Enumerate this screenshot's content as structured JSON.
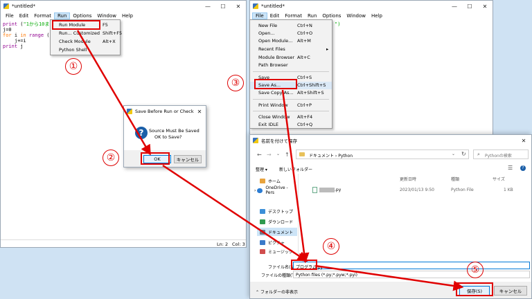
{
  "left_window": {
    "title": "*untitled*",
    "menu": [
      "File",
      "Edit",
      "Format",
      "Run",
      "Options",
      "Window",
      "Help"
    ],
    "code": [
      [
        [
          "bi",
          "print"
        ],
        [
          "t",
          " ("
        ],
        [
          "str",
          "\"1から10ま"
        ]
      ],
      [
        [
          "t",
          "j=0"
        ]
      ],
      [
        [
          "kw",
          "for"
        ],
        [
          "t",
          " i "
        ],
        [
          "kw",
          "in"
        ],
        [
          "t",
          " "
        ],
        [
          "bi",
          "range"
        ],
        [
          "t",
          " ("
        ]
      ],
      [
        [
          "t",
          "    j+=i"
        ]
      ],
      [
        [
          "bi",
          "print"
        ],
        [
          "t",
          " j"
        ]
      ]
    ],
    "status_ln": "Ln: 2",
    "status_col": "Col: 3"
  },
  "run_menu": {
    "items": [
      {
        "label": "Run Module",
        "shortcut": "F5"
      },
      {
        "label": "Run... Customized",
        "shortcut": "Shift+F5"
      },
      {
        "label": "Check Module",
        "shortcut": "Alt+X"
      },
      {
        "label": "Python Shell",
        "shortcut": ""
      }
    ]
  },
  "dialog": {
    "title": "Save Before Run or Check",
    "line1": "Source Must Be Saved",
    "line2": "OK to Save?",
    "ok_label": "OK",
    "cancel_label": "キャンセル"
  },
  "right_window": {
    "title": "*untitled*",
    "menu": [
      "File",
      "Edit",
      "Format",
      "Run",
      "Options",
      "Window",
      "Help"
    ],
    "code_fragment": "\")"
  },
  "file_menu": {
    "items": [
      {
        "label": "New File",
        "shortcut": "Ctrl+N"
      },
      {
        "label": "Open...",
        "shortcut": "Ctrl+O"
      },
      {
        "label": "Open Module...",
        "shortcut": "Alt+M"
      },
      {
        "label": "Recent Files",
        "shortcut": "▸"
      },
      {
        "label": "Module Browser",
        "shortcut": "Alt+C"
      },
      {
        "label": "Path Browser",
        "shortcut": ""
      },
      {
        "label": "Save",
        "shortcut": "Ctrl+S"
      },
      {
        "label": "Save As...",
        "shortcut": "Ctrl+Shift+S"
      },
      {
        "label": "Save Copy As...",
        "shortcut": "Alt+Shift+S"
      },
      {
        "label": "Print Window",
        "shortcut": "Ctrl+P"
      },
      {
        "label": "Close Window",
        "shortcut": "Alt+F4"
      },
      {
        "label": "Exit IDLE",
        "shortcut": "Ctrl+Q"
      }
    ]
  },
  "save_dialog": {
    "title": "名前を付けて保存",
    "breadcrumb": "ドキュメント  ›  Python",
    "search_placeholder": "Pythonの検索",
    "organize": "整理 ▾",
    "new_folder": "新しいフォルダー",
    "nav": [
      {
        "label": "ホーム",
        "color": "#e8a33d"
      },
      {
        "label": "OneDrive - Pers",
        "color": "#2b7cd3"
      },
      {
        "label": "デスクトップ",
        "color": "#3c8fd8"
      },
      {
        "label": "ダウンロード",
        "color": "#2e9a4f"
      },
      {
        "label": "ドキュメント",
        "color": "#6d7b8a"
      },
      {
        "label": "ピクチャ",
        "color": "#3a7ac9"
      },
      {
        "label": "ミュージック",
        "color": "#d04d4d"
      }
    ],
    "col_date": "更新日時",
    "col_type": "種類",
    "col_size": "サイズ",
    "file_name": ".py",
    "file_date": "2023/01/13 9:50",
    "file_type": "Python File",
    "file_size": "1 KB",
    "filename_label": "ファイル名(N):",
    "filename_value": "プログラム.py",
    "filetype_label": "ファイルの種類(T):",
    "filetype_value": "Python files (*.py;*.pyw;*.pyi)",
    "hide_folders": "フォルダーの非表示",
    "save_label": "保存(S)",
    "cancel_label": "キャンセル"
  },
  "steps": [
    "①",
    "②",
    "③",
    "④",
    "⑤"
  ],
  "colors": {
    "annotation": "#e00000",
    "highlight": "#0078d7"
  }
}
